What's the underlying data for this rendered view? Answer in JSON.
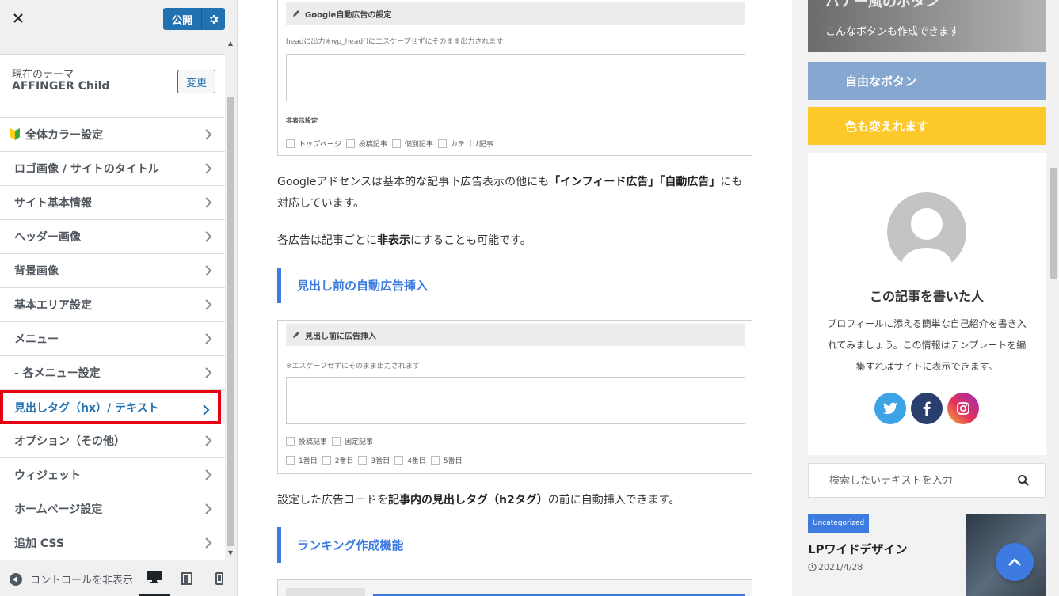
{
  "header": {
    "close_icon": "close-icon",
    "publish_label": "公開",
    "publish_settings_icon": "gear-icon",
    "brand_color": "#2271b1"
  },
  "theme": {
    "label": "現在のテーマ",
    "name": "AFFINGER Child",
    "change_label": "変更"
  },
  "menu": {
    "items": [
      {
        "label": "全体カラー設定",
        "icon": "beginner-leaf-icon"
      },
      {
        "label": "ロゴ画像 / サイトのタイトル"
      },
      {
        "label": "サイト基本情報"
      },
      {
        "label": "ヘッダー画像"
      },
      {
        "label": "背景画像"
      },
      {
        "label": "基本エリア設定"
      },
      {
        "label": "メニュー"
      },
      {
        "label": "- 各メニュー設定"
      },
      {
        "label": "見出しタグ（hx）/ テキスト",
        "highlighted": true
      },
      {
        "label": "オプション（その他）"
      },
      {
        "label": "ウィジェット"
      },
      {
        "label": "ホームページ設定"
      },
      {
        "label": "追加 CSS"
      }
    ]
  },
  "footer": {
    "hide_controls_label": "コントロールを非表示",
    "devices": [
      "desktop-icon",
      "tablet-icon",
      "mobile-icon"
    ],
    "active_device": "desktop"
  },
  "article": {
    "shot1": {
      "title": "Google自動広告の設定",
      "hint": "headに出力※wp_head()にエスケープせずにそのまま出力されます",
      "sub_label": "非表示設定",
      "checkboxes": [
        "トップページ",
        "投稿記事",
        "個別記事",
        "カテゴリ記事"
      ]
    },
    "para1_a": "Googleアドセンスは基本的な記事下広告表示の他にも",
    "para1_b": "「インフィード広告」「自動広告」",
    "para1_c": "にも対応しています。",
    "para2_a": "各広告は記事ごとに",
    "para2_b": "非表示",
    "para2_c": "にすることも可能です。",
    "heading1": "見出し前の自動広告挿入",
    "shot2": {
      "title": "見出し前に広告挿入",
      "hint": "※エスケープせずにそのまま出力されます",
      "checkboxes_row1": [
        "投稿記事",
        "固定記事"
      ],
      "checkboxes_row2": [
        "1番目",
        "2番目",
        "3番目",
        "4番目",
        "5番目"
      ]
    },
    "para3_a": "設定した広告コードを",
    "para3_b": "記事内の見出しタグ（h2タグ）",
    "para3_c": "の前に自動挿入できます。",
    "heading2": "ランキング作成機能",
    "accent_color": "#3d7be0"
  },
  "sidebar_widgets": {
    "banner_title": "バナー風のボタン",
    "banner_sub": "こんなボタンも作成できます",
    "button1": "自由なボタン",
    "button1_color": "#86a8d0",
    "button2": "色も変えれます",
    "button2_color": "#fcc82a",
    "author_title": "この記事を書いた人",
    "author_text": "プロフィールに添える簡単な自己紹介を書き入れてみましょう。この情報はテンプレートを編集すればサイトに表示できます。",
    "sns": [
      "twitter-icon",
      "facebook-icon",
      "instagram-icon"
    ],
    "search_placeholder": "検索したいテキストを入力",
    "post": {
      "category": "Uncategorized",
      "title": "LPワイドデザイン",
      "date": "2021/4/28"
    }
  }
}
